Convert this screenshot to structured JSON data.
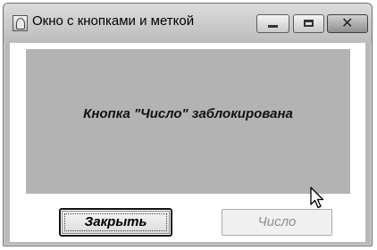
{
  "window": {
    "title": "Окно с кнопками и меткой",
    "controls": {
      "minimize_icon": "minimize-icon",
      "maximize_icon": "maximize-icon",
      "close_icon": "close-icon",
      "close_glyph": "✕"
    }
  },
  "label": {
    "text": "Кнопка \"Число\" заблокирована"
  },
  "buttons": {
    "close_label": "Закрыть",
    "number_label": "Число",
    "number_enabled": false
  },
  "colors": {
    "label_background": "#b3b3b3",
    "disabled_text": "#8e8e8e"
  }
}
